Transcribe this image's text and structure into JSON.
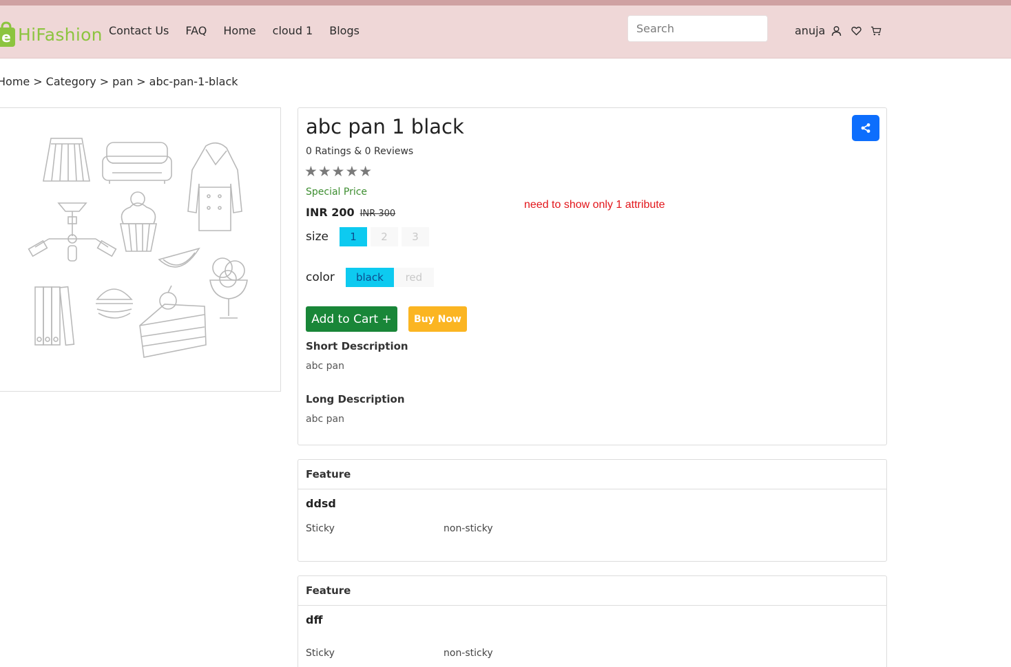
{
  "brand": {
    "name": "HiFashion",
    "accent": "#8cc43f"
  },
  "nav": {
    "links": [
      "Contact Us",
      "FAQ",
      "Home",
      "cloud 1",
      "Blogs"
    ]
  },
  "search": {
    "placeholder": "Search"
  },
  "user": {
    "name": "anuja",
    "icons": [
      "user-icon",
      "heart-icon",
      "cart-icon"
    ]
  },
  "breadcrumb": [
    "Home",
    "Category",
    "pan",
    "abc-pan-1-black"
  ],
  "product": {
    "title": "abc pan 1 black",
    "ratings_text": "0 Ratings & 0 Reviews",
    "stars": "★★★★★",
    "special_label": "Special Price",
    "price": "INR 200",
    "old_price": "INR 300",
    "note": "need to show only 1 attribute",
    "size": {
      "label": "size",
      "options": [
        "1",
        "2",
        "3"
      ],
      "selected": "1"
    },
    "color": {
      "label": "color",
      "options": [
        "black",
        "red"
      ],
      "selected": "black"
    },
    "add_to_cart": "Add to Cart +",
    "buy_now": "Buy Now",
    "short_desc_heading": "Short Description",
    "short_desc": "abc pan",
    "long_desc_heading": "Long Description",
    "long_desc": "abc pan"
  },
  "features": [
    {
      "header": "Feature",
      "title": "ddsd",
      "key": "Sticky",
      "value": "non-sticky"
    },
    {
      "header": "Feature",
      "title": "dff",
      "key": "Sticky",
      "value": "non-sticky"
    }
  ],
  "colors": {
    "navbar": "#efd7d7",
    "share": "#0d6efd",
    "cart": "#198638",
    "buy": "#fbb522",
    "selected_option": "#0dcaf0",
    "note": "#e2151a"
  }
}
